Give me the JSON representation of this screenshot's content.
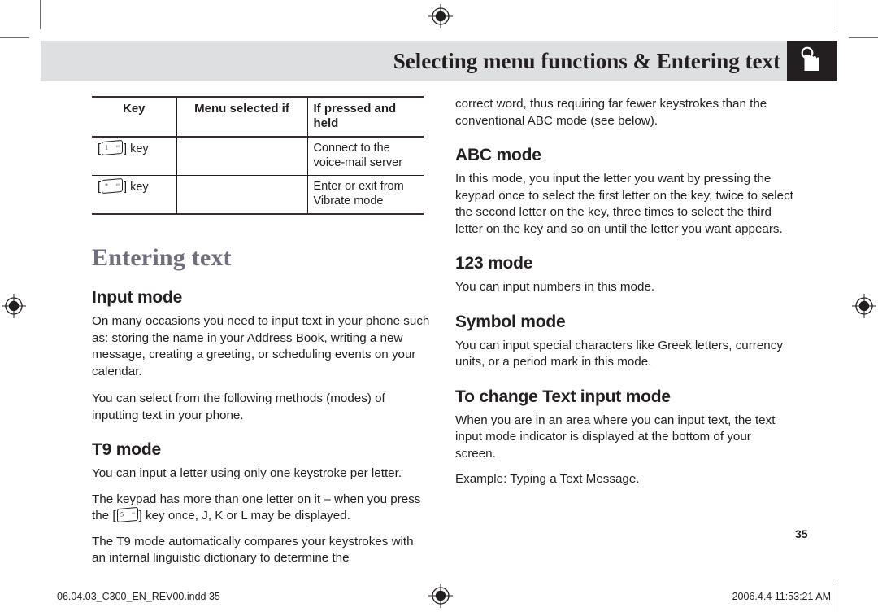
{
  "header": {
    "title": "Selecting menu functions & Entering text",
    "icon": "hand-press-icon"
  },
  "key_table": {
    "columns": [
      "Key",
      "Menu selected if",
      "If pressed and held"
    ],
    "rows": [
      {
        "key_prefix": "[",
        "key_digit": "1",
        "key_suffix": "] key",
        "key_label": "[1] key",
        "menu_selected_if": "",
        "if_pressed_and_held": "Connect to the voice-mail server"
      },
      {
        "key_prefix": "[",
        "key_digit": "*",
        "key_suffix": "] key",
        "key_label": "[*] key",
        "menu_selected_if": "",
        "if_pressed_and_held": "Enter or exit from Vibrate mode"
      }
    ]
  },
  "left_column": {
    "section_title": "Entering text",
    "input_mode": {
      "heading": "Input mode",
      "p1": "On many occasions you need to input text in your phone such as: storing the name in your Address Book, writing a new message, creating a greeting, or scheduling events on your calendar.",
      "p2": "You can select from the following methods (modes) of inputting text in your phone."
    },
    "t9_mode": {
      "heading": "T9 mode",
      "p1": "You can input a letter using only one keystroke per letter.",
      "p2_before": "The keypad has more than one letter on it – when you press the [",
      "p2_key_digit": "5",
      "p2_after": "] key once, J, K or L may be displayed.",
      "p3": "The T9 mode automatically compares your keystrokes with an internal linguistic dictionary to determine the"
    }
  },
  "right_column": {
    "continuation": "correct word, thus requiring far fewer keystrokes than the conventional ABC mode (see below).",
    "abc_mode": {
      "heading": "ABC mode",
      "p1": "In this mode, you input the letter you want by pressing the keypad once to select the first letter on the key, twice to select the second letter on the key, three times to select the third letter on the key and so on until the letter you want appears."
    },
    "mode_123": {
      "heading": "123 mode",
      "p1": "You can input numbers in this mode."
    },
    "symbol_mode": {
      "heading": "Symbol mode",
      "p1": "You can input special characters like Greek letters, currency units, or a period mark in this mode."
    },
    "change_input_mode": {
      "heading": "To change Text input mode",
      "p1": "When you are in an area where you can input text, the text input mode indicator is displayed at the bottom of your screen.",
      "p2": "Example: Typing a Text Message."
    }
  },
  "page_number": "35",
  "footer": {
    "file_name": "06.04.03_C300_EN_REV00.indd   35",
    "timestamp": "2006.4.4   11:53:21 AM"
  },
  "colors": {
    "header_band": "#dedfe1",
    "header_icon_box": "#231f20",
    "section_title": "#6e6e7c",
    "text": "#231f20",
    "crop_marks": "#6d6e71"
  }
}
